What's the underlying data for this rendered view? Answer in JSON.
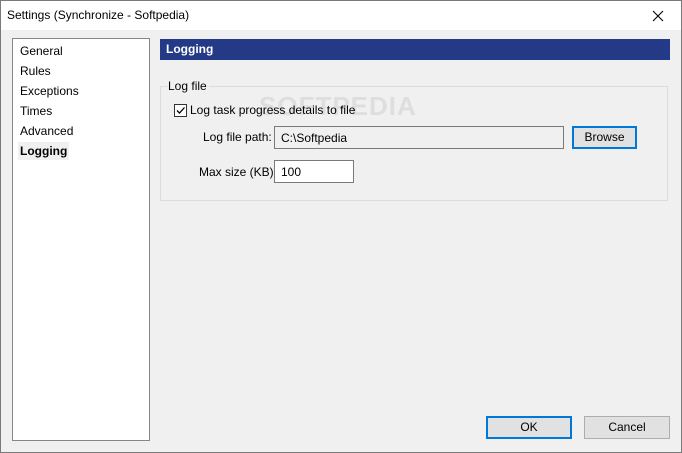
{
  "window": {
    "title": "Settings (Synchronize - Softpedia)"
  },
  "nav": {
    "items": [
      {
        "label": "General",
        "selected": false
      },
      {
        "label": "Rules",
        "selected": false
      },
      {
        "label": "Exceptions",
        "selected": false
      },
      {
        "label": "Times",
        "selected": false
      },
      {
        "label": "Advanced",
        "selected": false
      },
      {
        "label": "Logging",
        "selected": true
      }
    ]
  },
  "section": {
    "header": "Logging",
    "header_color": "#243a87"
  },
  "log_file": {
    "group_label": "Log file",
    "checkbox_label": "Log task progress details to file",
    "checkbox_checked": true,
    "path_label": "Log file path:",
    "path_value": "C:\\Softpedia",
    "browse_label": "Browse",
    "max_size_label": "Max size (KB):",
    "max_size_value": "100"
  },
  "footer": {
    "ok_label": "OK",
    "cancel_label": "Cancel"
  },
  "watermark": "SOFTPEDIA",
  "icons": {
    "close": "close-icon",
    "check": "checkmark-icon"
  }
}
